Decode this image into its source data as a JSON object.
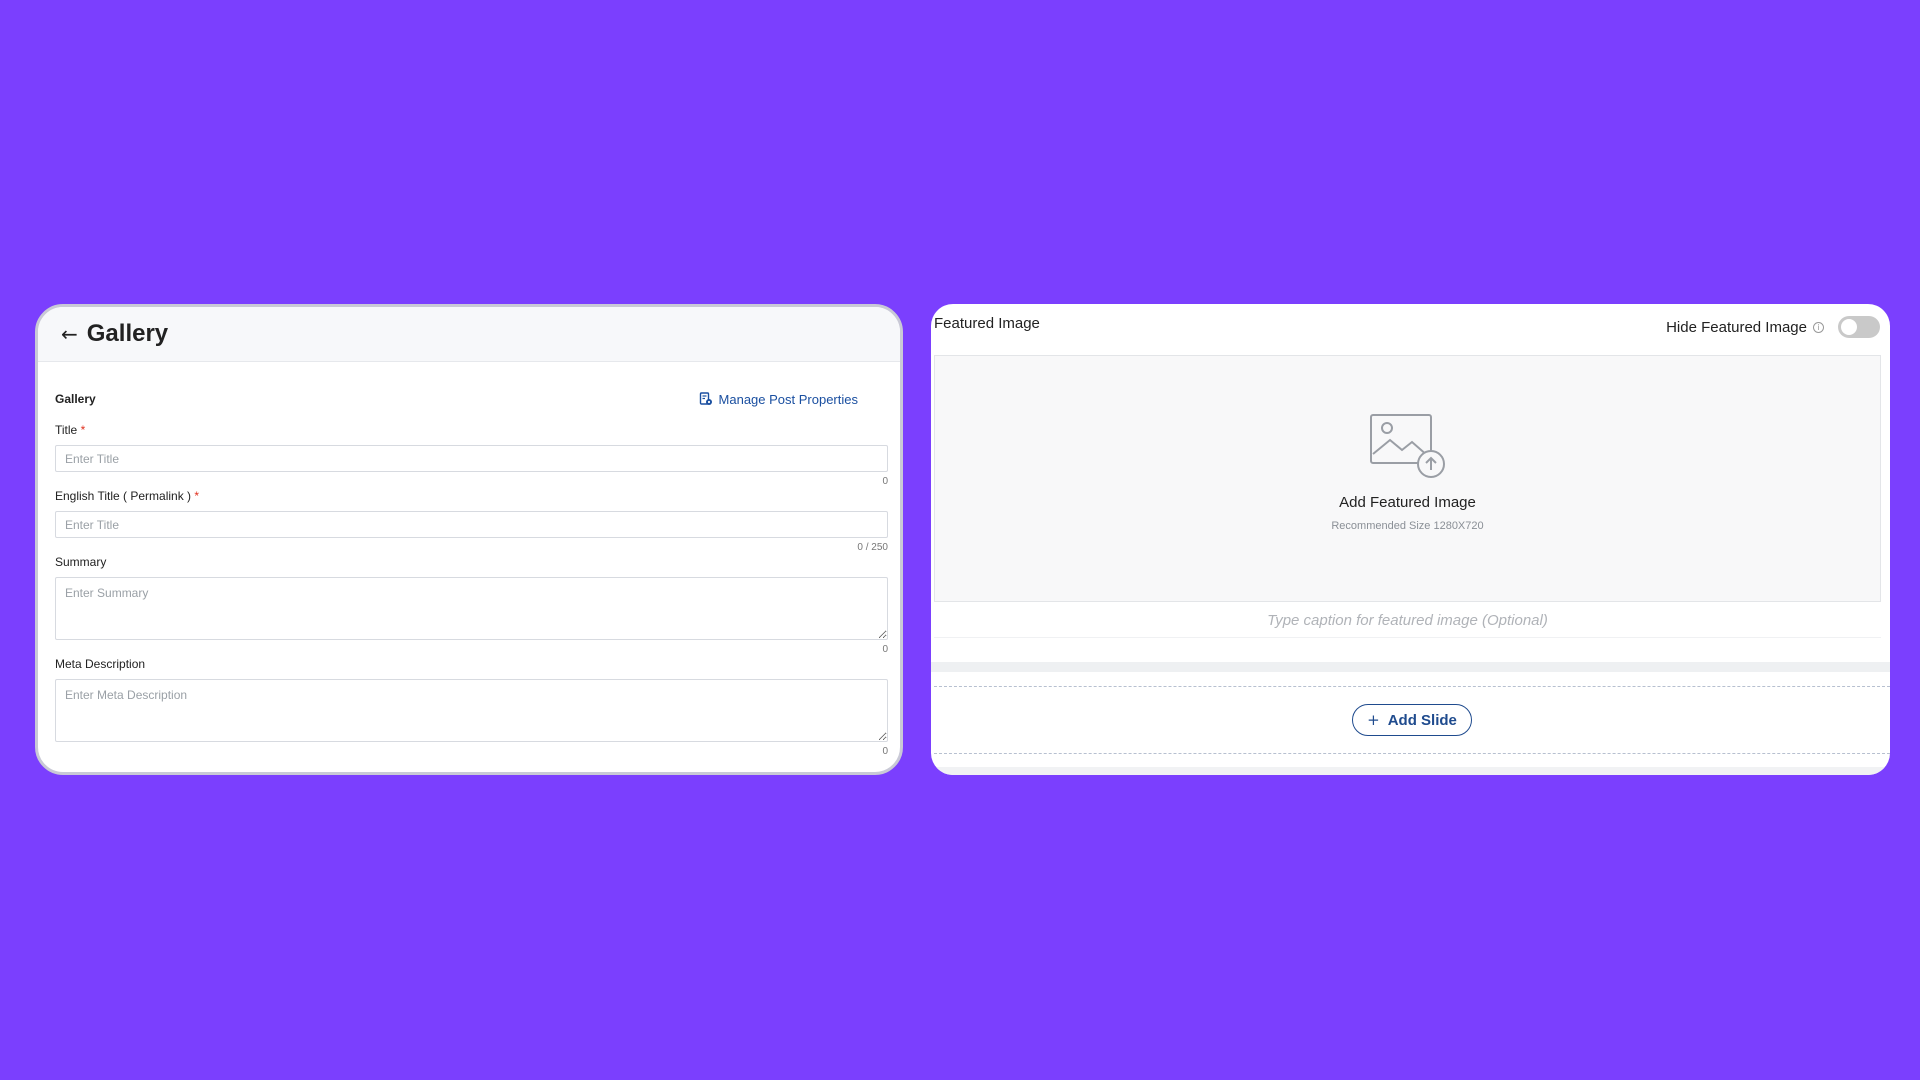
{
  "colors": {
    "background": "#7b3ffe",
    "link": "#1a4fa0",
    "required": "#e0301e",
    "button_outline": "#1f4b8e"
  },
  "left_panel": {
    "back_icon": "arrow-left-icon",
    "title": "Gallery",
    "section_label": "Gallery",
    "manage_link": "Manage Post Properties",
    "manage_icon": "document-gear-icon",
    "fields": {
      "title": {
        "label": "Title",
        "required_mark": "*",
        "placeholder": "Enter Title",
        "counter": "0"
      },
      "english_title": {
        "label": "English Title ( Permalink )",
        "required_mark": "*",
        "placeholder": "Enter Title",
        "counter": "0 / 250"
      },
      "summary": {
        "label": "Summary",
        "placeholder": "Enter Summary",
        "counter": "0"
      },
      "meta_description": {
        "label": "Meta Description",
        "placeholder": "Enter Meta Description",
        "counter": "0"
      }
    }
  },
  "right_panel": {
    "featured_image_title": "Featured Image",
    "hide_featured_label": "Hide Featured Image",
    "info_icon": "info-icon",
    "hide_toggle_on": false,
    "upload": {
      "icon": "image-upload-icon",
      "title": "Add Featured Image",
      "subtitle": "Recommended Size 1280X720"
    },
    "caption_placeholder": "Type caption for featured image (Optional)",
    "add_slide_label": "Add Slide",
    "add_slide_icon": "plus-icon"
  }
}
